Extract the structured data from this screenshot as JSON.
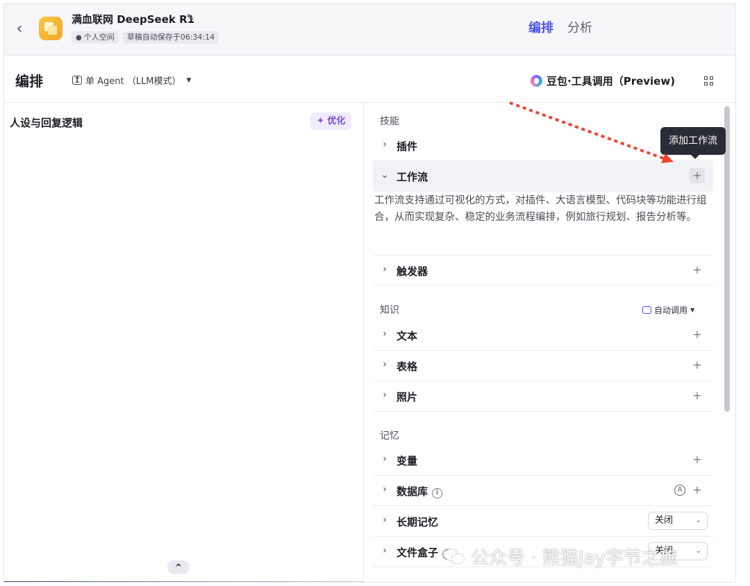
{
  "header": {
    "back_icon": "chevron-left-icon",
    "app_name": "满血联网 DeepSeek R1",
    "space_label": "个人空间",
    "draft_status": "草稿自动保存于06:34:14",
    "tabs": [
      {
        "label": "编排",
        "active": true
      },
      {
        "label": "分析",
        "active": false
      }
    ],
    "accent_color": "#4d53e8"
  },
  "subheader": {
    "title": "编排",
    "agent_mode": "单 Agent （LLM模式）",
    "model_name": "豆包·工具调用（Preview)",
    "layout_icon": "grid-layout-icon"
  },
  "left_panel": {
    "persona_title": "人设与回复逻辑",
    "optimize_label": "优化"
  },
  "right_panel": {
    "skills": {
      "title": "技能",
      "items": [
        {
          "label": "插件"
        },
        {
          "label": "工作流",
          "expanded": true,
          "description": "工作流支持通过可视化的方式，对插件、大语言模型、代码块等功能进行组合，从而实现复杂、稳定的业务流程编排，例如旅行规划、报告分析等。"
        },
        {
          "label": "触发器"
        }
      ]
    },
    "knowledge": {
      "title": "知识",
      "auto_call_label": "自动调用",
      "items": [
        {
          "label": "文本"
        },
        {
          "label": "表格"
        },
        {
          "label": "照片"
        }
      ]
    },
    "memory": {
      "title": "记忆",
      "items": [
        {
          "label": "变量"
        },
        {
          "label": "数据库"
        },
        {
          "label": "长期记忆",
          "select_value": "关闭"
        },
        {
          "label": "文件盒子",
          "select_value": "关闭"
        }
      ]
    },
    "tooltip": "添加工作流"
  },
  "watermark": "公众号 · 熊猫Jay字节之旅",
  "annotation_color": "#ee4433"
}
